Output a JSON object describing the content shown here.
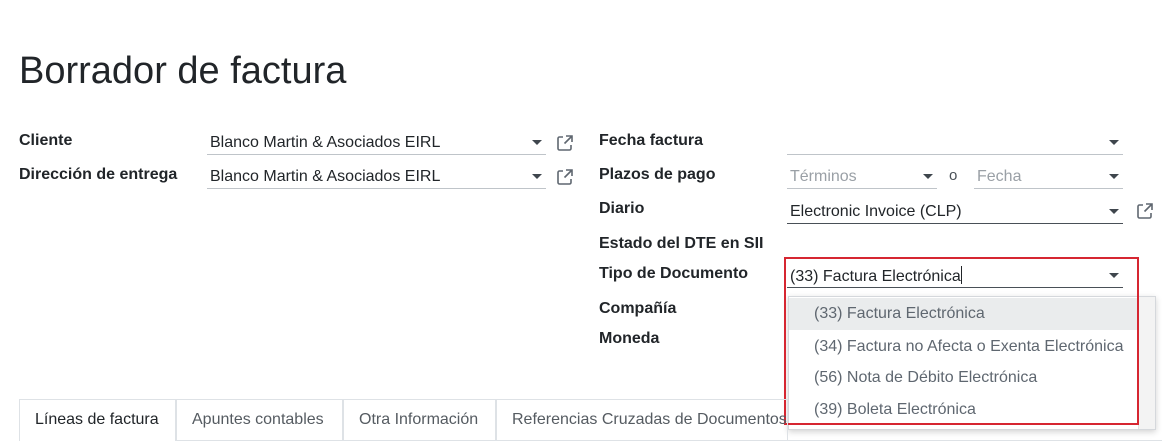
{
  "page": {
    "title": "Borrador de factura"
  },
  "left_fields": {
    "cliente": {
      "label": "Cliente",
      "value": "Blanco Martin & Asociados EIRL"
    },
    "direccion": {
      "label": "Dirección de entrega",
      "value": "Blanco Martin & Asociados EIRL"
    }
  },
  "right_fields": {
    "fecha_factura": {
      "label": "Fecha factura",
      "value": ""
    },
    "plazos_pago": {
      "label": "Plazos de pago",
      "terminos_placeholder": "Términos",
      "separator": "o",
      "fecha_placeholder": "Fecha"
    },
    "diario": {
      "label": "Diario",
      "value": "Electronic Invoice (CLP)"
    },
    "estado_dte": {
      "label": "Estado del DTE en SII"
    },
    "tipo_documento": {
      "label": "Tipo de Documento",
      "value": "(33) Factura Electrónica"
    },
    "compania": {
      "label": "Compañía"
    },
    "moneda": {
      "label": "Moneda"
    }
  },
  "dropdown": {
    "options": [
      "(33) Factura Electrónica",
      "(34) Factura no Afecta o Exenta Electrónica",
      "(56) Nota de Débito Electrónica",
      "(39) Boleta Electrónica"
    ],
    "highlighted_index": 0
  },
  "tabs": [
    {
      "label": "Líneas de factura",
      "active": true
    },
    {
      "label": "Apuntes contables",
      "active": false
    },
    {
      "label": "Otra Información",
      "active": false
    },
    {
      "label": "Referencias Cruzadas de Documentos",
      "active": false
    }
  ],
  "colors": {
    "highlight_border": "#d62631",
    "dropdown_hover": "#eaeced"
  },
  "icons": {
    "dropdown": "caret-down-icon",
    "external": "external-link-icon"
  }
}
